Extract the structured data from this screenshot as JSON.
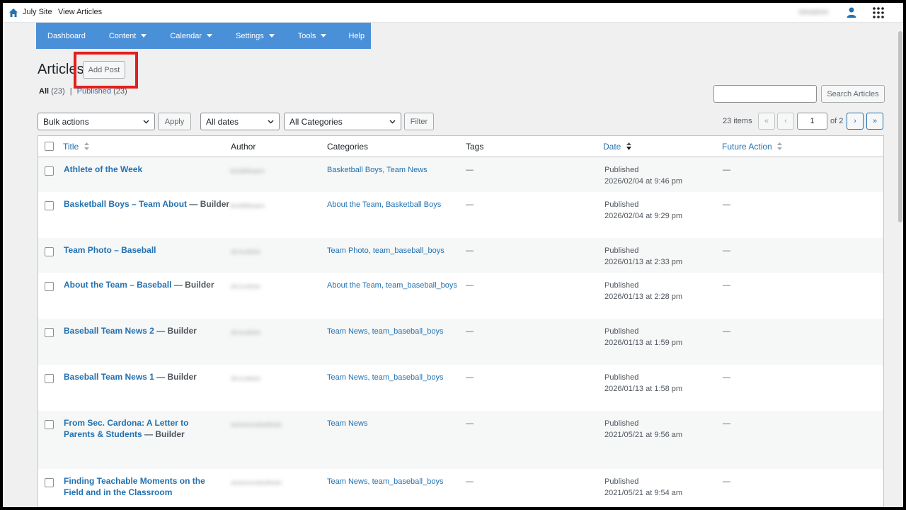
{
  "topbar": {
    "site_name": "July Site",
    "view_link": "View Articles",
    "user_name": "siteadmin"
  },
  "nav": [
    {
      "label": "Dashboard",
      "dropdown": false
    },
    {
      "label": "Content",
      "dropdown": true
    },
    {
      "label": "Calendar",
      "dropdown": true
    },
    {
      "label": "Settings",
      "dropdown": true
    },
    {
      "label": "Tools",
      "dropdown": true
    },
    {
      "label": "Help",
      "dropdown": false
    }
  ],
  "page": {
    "title": "Articles",
    "add_button": "Add Post"
  },
  "status_filter": {
    "all_label": "All",
    "all_count": "(23)",
    "separator": "|",
    "published_label": "Published",
    "published_count": "(23)"
  },
  "search": {
    "value": "",
    "button": "Search Articles"
  },
  "filters": {
    "bulk_actions": "Bulk actions",
    "apply": "Apply",
    "dates": "All dates",
    "categories": "All Categories",
    "filter": "Filter"
  },
  "pagination": {
    "items": "23 items",
    "first": "«",
    "prev": "‹",
    "current_page": "1",
    "of_pages": "of 2",
    "next": "›",
    "last": "»"
  },
  "table": {
    "columns": {
      "title": "Title",
      "author": "Author",
      "categories": "Categories",
      "tags": "Tags",
      "date": "Date",
      "future_action": "Future Action"
    },
    "rows": [
      {
        "title": "Athlete of the Week",
        "state": "",
        "author": "kmildreen",
        "categories": "Basketball Boys, Team News",
        "tags": "—",
        "status": "Published",
        "date": "2026/02/04 at 9:46 pm",
        "future_action": "—"
      },
      {
        "title": "Basketball Boys – Team About",
        "state": " — Builder",
        "author": "kmildreen",
        "categories": "About the Team, Basketball Boys",
        "tags": "—",
        "status": "Published",
        "date": "2026/02/04 at 9:29 pm",
        "future_action": "—"
      },
      {
        "title": "Team Photo – Baseball",
        "state": "",
        "author": "dcoubrin",
        "categories": "Team Photo, team_baseball_boys",
        "tags": "—",
        "status": "Published",
        "date": "2026/01/13 at 2:33 pm",
        "future_action": "—"
      },
      {
        "title": "About the Team – Baseball",
        "state": " — Builder",
        "author": "dcoubrin",
        "categories": "About the Team, team_baseball_boys",
        "tags": "—",
        "status": "Published",
        "date": "2026/01/13 at 2:28 pm",
        "future_action": "—"
      },
      {
        "title": "Baseball Team News 2",
        "state": " — Builder",
        "author": "dcoubrin",
        "categories": "Team News, team_baseball_boys",
        "tags": "—",
        "status": "Published",
        "date": "2026/01/13 at 1:59 pm",
        "future_action": "—"
      },
      {
        "title": "Baseball Team News 1",
        "state": " — Builder",
        "author": "dcoubrin",
        "categories": "Team News, team_baseball_boys",
        "tags": "—",
        "status": "Published",
        "date": "2026/01/13 at 1:58 pm",
        "future_action": "—"
      },
      {
        "title": "From Sec. Cardona: A Letter to Parents & Students",
        "state": " — Builder",
        "author": "approvaladmin",
        "categories": "Team News",
        "tags": "—",
        "status": "Published",
        "date": "2021/05/21 at 9:56 am",
        "future_action": "—"
      },
      {
        "title": "Finding Teachable Moments on the Field and in the Classroom",
        "state": "",
        "author": "approvaladmin",
        "categories": "Team News, team_baseball_boys",
        "tags": "—",
        "status": "Published",
        "date": "2021/05/21 at 9:54 am",
        "future_action": "—"
      }
    ]
  },
  "colors": {
    "nav_bg": "#4a90d9",
    "link": "#2271b1",
    "highlight": "#e31e1e"
  }
}
